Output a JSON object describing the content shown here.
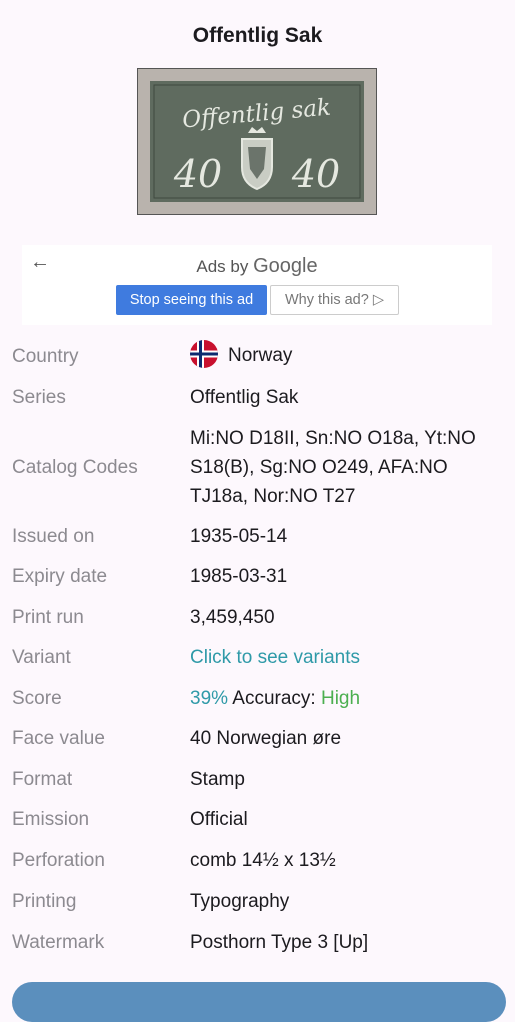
{
  "page": {
    "title": "Offentlig Sak"
  },
  "stamp": {
    "top_text": "Offentlig sak",
    "left_value": "40",
    "right_value": "40"
  },
  "ad": {
    "back_icon": "arrow-left-icon",
    "ads_by": "Ads by",
    "google": "Google",
    "stop_label": "Stop seeing this ad",
    "why_label": "Why this ad? ▷"
  },
  "details": {
    "country": {
      "label": "Country",
      "value": "Norway",
      "icon": "norway-flag-icon"
    },
    "series": {
      "label": "Series",
      "value": "Offentlig Sak"
    },
    "catalog": {
      "label": "Catalog Codes",
      "value": "Mi:NO D18II, Sn:NO O18a, Yt:NO S18(B), Sg:NO O249, AFA:NO TJ18a, Nor:NO T27"
    },
    "issued": {
      "label": "Issued on",
      "value": "1935-05-14"
    },
    "expiry": {
      "label": "Expiry date",
      "value": "1985-03-31"
    },
    "print_run": {
      "label": "Print run",
      "value": "3,459,450"
    },
    "variant": {
      "label": "Variant",
      "value": "Click to see variants"
    },
    "score": {
      "label": "Score",
      "percent": "39%",
      "accuracy_label": "Accuracy:",
      "accuracy_value": "High"
    },
    "face_value": {
      "label": "Face value",
      "value": "40 Norwegian øre"
    },
    "format": {
      "label": "Format",
      "value": "Stamp"
    },
    "emission": {
      "label": "Emission",
      "value": "Official"
    },
    "perforation": {
      "label": "Perforation",
      "value": "comb 14½ x 13½"
    },
    "printing": {
      "label": "Printing",
      "value": "Typography"
    },
    "watermark": {
      "label": "Watermark",
      "value": "Posthorn Type 3 [Up]"
    }
  },
  "colors": {
    "label": "#8c8a90",
    "link": "#2f9aa8",
    "high": "#4caf50",
    "ad_button": "#3f7bdf"
  }
}
